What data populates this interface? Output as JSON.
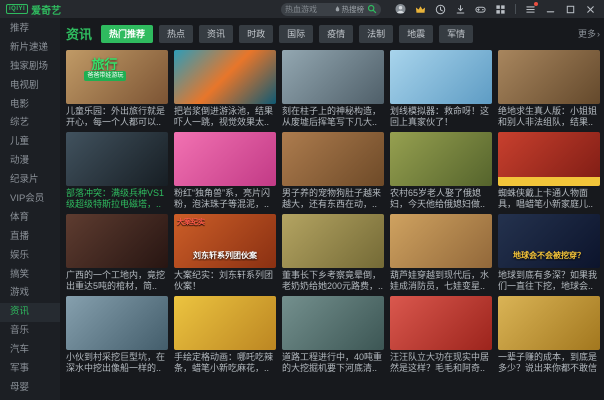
{
  "titlebar": {
    "logo_mark": "iQIYI",
    "logo_text": "爱奇艺",
    "search": {
      "placeholder": "热血游戏",
      "hot_label": "热搜榜"
    },
    "icons": [
      "user-avatar",
      "vip-crown",
      "history-clock",
      "download",
      "game-controller",
      "apps-grid",
      "main-menu",
      "minimize",
      "maximize",
      "close"
    ]
  },
  "sidebar": {
    "items": [
      {
        "label": "推荐"
      },
      {
        "label": "新片速递"
      },
      {
        "label": "独家剧场"
      },
      {
        "label": "电视剧"
      },
      {
        "label": "电影"
      },
      {
        "label": "综艺"
      },
      {
        "label": "儿童"
      },
      {
        "label": "动漫"
      },
      {
        "label": "纪录片"
      },
      {
        "label": "VIP会员"
      },
      {
        "label": "体育"
      },
      {
        "label": "直播"
      },
      {
        "label": "娱乐"
      },
      {
        "label": "搞笑"
      },
      {
        "label": "游戏"
      },
      {
        "label": "资讯",
        "active": true
      },
      {
        "label": "音乐"
      },
      {
        "label": "汽车"
      },
      {
        "label": "军事"
      },
      {
        "label": "母婴"
      }
    ]
  },
  "content": {
    "section_title": "资讯",
    "tabs": [
      {
        "label": "热门推荐",
        "active": true
      },
      {
        "label": "热点"
      },
      {
        "label": "资讯"
      },
      {
        "label": "时政"
      },
      {
        "label": "国际"
      },
      {
        "label": "疫情"
      },
      {
        "label": "法制"
      },
      {
        "label": "地震"
      },
      {
        "label": "军情"
      }
    ],
    "more_label": "更多",
    "more_chevron": "›",
    "cards": [
      {
        "title": "儿童乐园：外出旅行就是开心，每一个人都可以..",
        "thumb": [
          "#c09a66",
          "#7c5434"
        ],
        "stamp": "旅行",
        "stamp_sub": "爸爸带娃游玩"
      },
      {
        "title": "把岩浆倒进游泳池，结果吓人一跳，视觉效果太..",
        "thumb": [
          "#2e9cb8",
          "#e8762a",
          "#0f5a74"
        ]
      },
      {
        "title": "刻在柱子上的神秘构造，从废墟后挥笔写下几大..",
        "thumb": [
          "#93a7b1",
          "#4f5f69"
        ]
      },
      {
        "title": "划线模拟器：救命呀！这回上真家伙了！",
        "thumb": [
          "#a8d4ec",
          "#5e9cc4"
        ]
      },
      {
        "title": "绝地求生真人版：小姐姐和别人非法组队，结果..",
        "thumb": [
          "#a8865e",
          "#64492c"
        ]
      },
      {
        "title": "部落冲突：满级兵种VS1级超级特斯拉电磁塔，..",
        "green": true,
        "thumb": [
          "#41525e",
          "#171e24"
        ]
      },
      {
        "title": "粉红“独角兽”系，亮片闪粉，泡沫珠子等混泥，..",
        "thumb": [
          "#f272b2",
          "#c23a86"
        ]
      },
      {
        "title": "男子养的宠物狗肚子越来越大，还有东西在动，..",
        "thumb": [
          "#ad7c4e",
          "#6e4a28"
        ]
      },
      {
        "title": "农村65岁老人娶了俄媳妇，今天他给俄媳妇做..",
        "thumb": [
          "#96a050",
          "#55642c"
        ]
      },
      {
        "title": "蜘蛛侠戴上卡通人物面具，唱蜡笔小新家庭儿..",
        "thumb": [
          "#c8402e",
          "#7e1c14"
        ],
        "band": "#f2c53a"
      },
      {
        "title": "广西的一个工地内，竟挖出重达5吨的棺材，简..",
        "thumb": [
          "#5e3c30",
          "#271512"
        ]
      },
      {
        "title": "大案纪实：刘东轩系列团伙案！",
        "thumb": [
          "#cc5e28",
          "#8a3012"
        ],
        "badge": "大案纪实",
        "caption": "刘东轩系列团伙案"
      },
      {
        "title": "董事长下乡考察竟晕倒，老奶奶给她200元路费，..",
        "thumb": [
          "#b4a462",
          "#746a36"
        ]
      },
      {
        "title": "葫芦娃穿越到现代后，水娃成消防员，七娃变星..",
        "thumb": [
          "#cfa260",
          "#92683a"
        ]
      },
      {
        "title": "地球到底有多深？如果我们一直往下挖，地球会..",
        "thumb": [
          "#24324e",
          "#0c142c"
        ],
        "caption": "地球会不会被挖穿？",
        "caption_color": "#f5c53a"
      },
      {
        "title": "小伙到村采挖巨型坑，在深水中挖出像船一样的..",
        "thumb": [
          "#86a0ae",
          "#435d6b"
        ]
      },
      {
        "title": "手绘定格动画：哪吒吃辣条，蜡笔小新吃麻花，..",
        "thumb": [
          "#ecc440",
          "#bc8622"
        ]
      },
      {
        "title": "道路工程进行中，40吨重的大挖掘机要下河底清..",
        "thumb": [
          "#74908e",
          "#3c5654"
        ]
      },
      {
        "title": "汪汪队立大功在现实中居然是这样？毛毛和阿奇..",
        "thumb": [
          "#da584e",
          "#9c241c"
        ]
      },
      {
        "title": "一辈子赚的成本，到底是多少？说出来你都不敢信",
        "thumb": [
          "#dab456",
          "#a2771e"
        ]
      }
    ]
  },
  "colors": {
    "accent_green": "#2fbb5f",
    "vip_gold": "#e8b33a",
    "badge_red": "#ff5a4a",
    "notification_red": "#e84e40"
  }
}
